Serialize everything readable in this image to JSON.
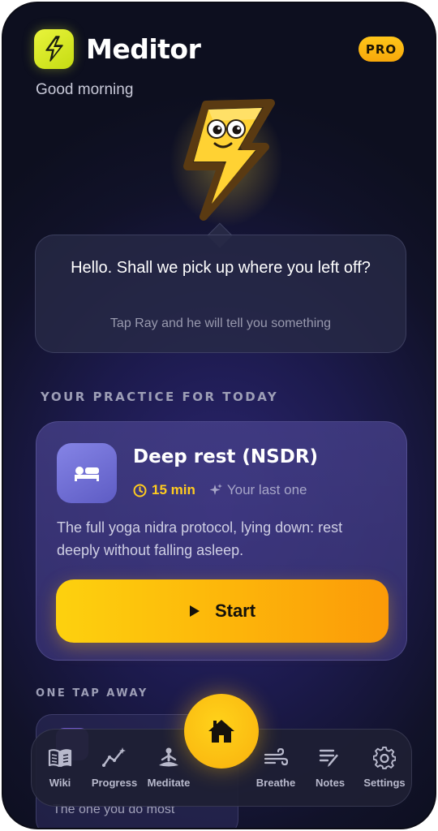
{
  "app": {
    "name": "Meditor",
    "badge": "PRO",
    "greeting": "Good morning"
  },
  "mascot": {
    "icon": "lightning-mascot-icon"
  },
  "speech": {
    "message": "Hello. Shall we pick up where you left off?",
    "hint": "Tap Ray and he will tell you something"
  },
  "practice": {
    "section_label": "YOUR PRACTICE FOR TODAY",
    "title": "Deep rest (NSDR)",
    "duration": "15 min",
    "tag": "Your last one",
    "description": "The full yoga nidra protocol, lying down: rest deeply without falling asleep.",
    "start_label": "Start",
    "icon": "bed-icon"
  },
  "quick": {
    "section_label": "ONE TAP AWAY",
    "subtitle": "The one you do most"
  },
  "tabs": [
    {
      "label": "Wiki",
      "icon": "book-icon"
    },
    {
      "label": "Progress",
      "icon": "chart-icon"
    },
    {
      "label": "Meditate",
      "icon": "meditate-icon"
    },
    {
      "label": "Home",
      "icon": "home-icon"
    },
    {
      "label": "Breathe",
      "icon": "wind-icon"
    },
    {
      "label": "Notes",
      "icon": "notes-icon"
    },
    {
      "label": "Settings",
      "icon": "gear-icon"
    }
  ],
  "colors": {
    "accent": "#FDB40A",
    "lime": "#D4E626",
    "card": "#3A3476",
    "background": "#15152E"
  }
}
